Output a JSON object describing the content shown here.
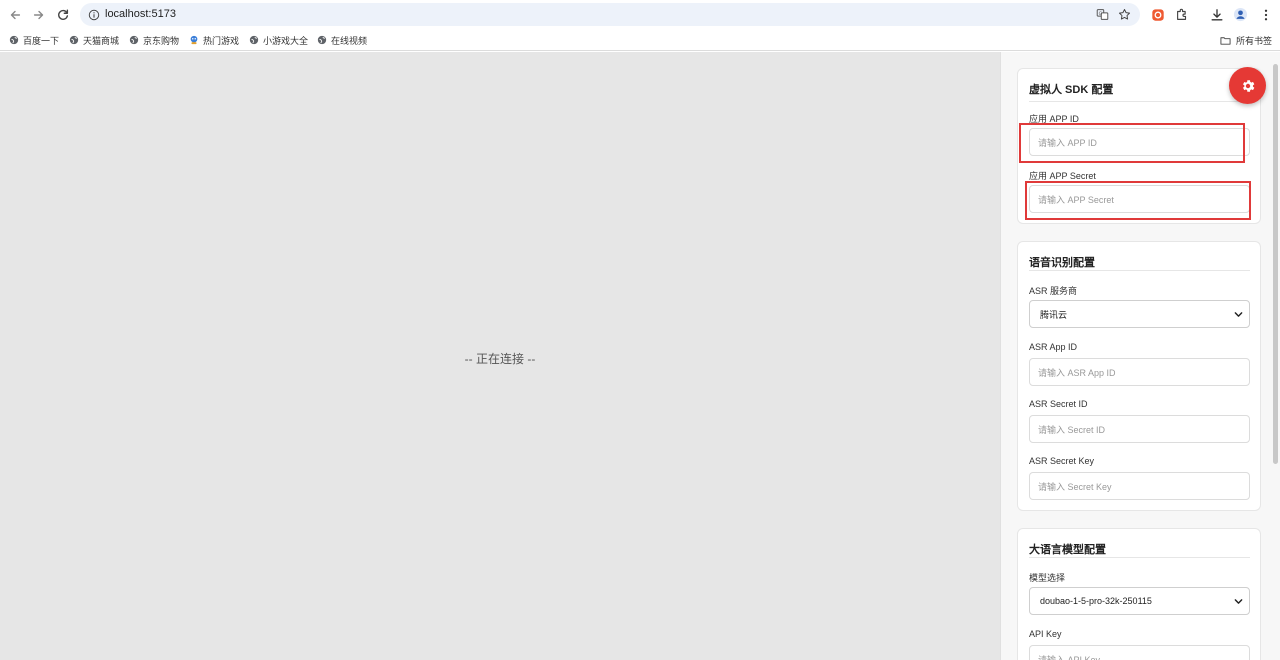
{
  "browser": {
    "url": "localhost:5173",
    "bookmarks": [
      {
        "label": "百度一下"
      },
      {
        "label": "天猫商城"
      },
      {
        "label": "京东购物"
      },
      {
        "label": "热门游戏"
      },
      {
        "label": "小游戏大全"
      },
      {
        "label": "在线视频"
      }
    ],
    "all_bookmarks_label": "所有书签"
  },
  "stage": {
    "status_text": "-- 正在连接 --"
  },
  "sdk_config": {
    "title": "虚拟人 SDK 配置",
    "app_id_label": "应用 APP ID",
    "app_id_placeholder": "请输入 APP ID",
    "app_secret_label": "应用 APP Secret",
    "app_secret_placeholder": "请输入 APP Secret"
  },
  "asr_config": {
    "title": "语音识别配置",
    "provider_label": "ASR 服务商",
    "provider_value": "腾讯云",
    "app_id_label": "ASR App ID",
    "app_id_placeholder": "请输入 ASR App ID",
    "secret_id_label": "ASR Secret ID",
    "secret_id_placeholder": "请输入 Secret ID",
    "secret_key_label": "ASR Secret Key",
    "secret_key_placeholder": "请输入 Secret Key"
  },
  "llm_config": {
    "title": "大语言模型配置",
    "model_label": "模型选择",
    "model_value": "doubao-1-5-pro-32k-250115",
    "api_key_label": "API Key",
    "api_key_placeholder": "请输入 API Key"
  },
  "colors": {
    "accent": "#e53935",
    "highlight": "#e03a3a",
    "stage_bg": "#e6e6e6"
  }
}
